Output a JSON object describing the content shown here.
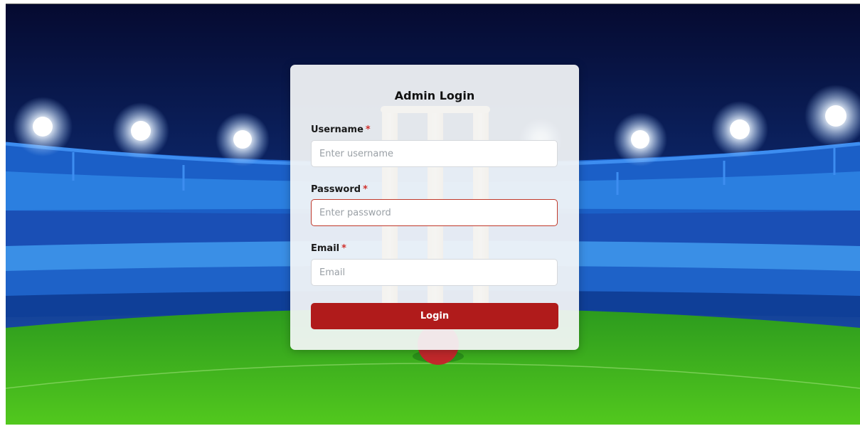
{
  "login": {
    "title": "Admin Login",
    "required_mark": "*",
    "username": {
      "label": "Username",
      "placeholder": "Enter username",
      "value": ""
    },
    "password": {
      "label": "Password",
      "placeholder": "Enter password",
      "value": ""
    },
    "email": {
      "label": "Email",
      "placeholder": "Email",
      "value": ""
    },
    "submit_label": "Login"
  },
  "colors": {
    "sky_top": "#07103a",
    "sky_bottom": "#1a4fb0",
    "stands": "#1f6fd0",
    "grass": "#3fb82a",
    "button": "#b01b1b",
    "required": "#d0302c"
  }
}
